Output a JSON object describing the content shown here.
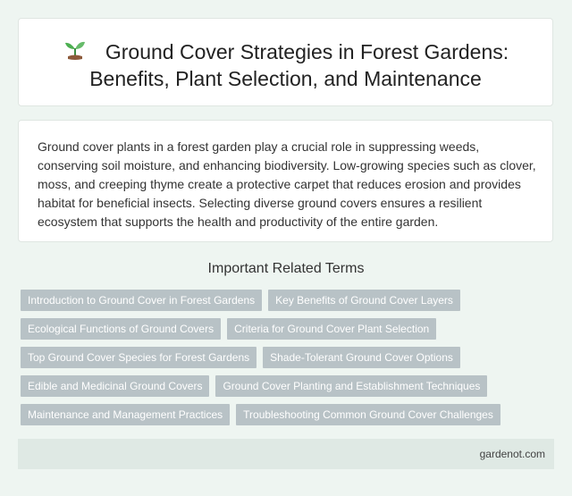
{
  "header": {
    "title_line1": "Ground Cover Strategies in Forest Gardens:",
    "title_line2": "Benefits, Plant Selection, and Maintenance",
    "icon": "sprout-icon"
  },
  "description": "Ground cover plants in a forest garden play a crucial role in suppressing weeds, conserving soil moisture, and enhancing biodiversity. Low-growing species such as clover, moss, and creeping thyme create a protective carpet that reduces erosion and provides habitat for beneficial insects. Selecting diverse ground covers ensures a resilient ecosystem that supports the health and productivity of the entire garden.",
  "related": {
    "heading": "Important Related Terms",
    "terms": [
      "Introduction to Ground Cover in Forest Gardens",
      "Key Benefits of Ground Cover Layers",
      "Ecological Functions of Ground Covers",
      "Criteria for Ground Cover Plant Selection",
      "Top Ground Cover Species for Forest Gardens",
      "Shade-Tolerant Ground Cover Options",
      "Edible and Medicinal Ground Covers",
      "Ground Cover Planting and Establishment Techniques",
      "Maintenance and Management Practices",
      "Troubleshooting Common Ground Cover Challenges"
    ]
  },
  "footer": {
    "site": "gardenot.com"
  },
  "colors": {
    "tag_bg": "#b8c2c6",
    "page_bg": "#eef5f1",
    "footer_bg": "#dfe9e4"
  }
}
